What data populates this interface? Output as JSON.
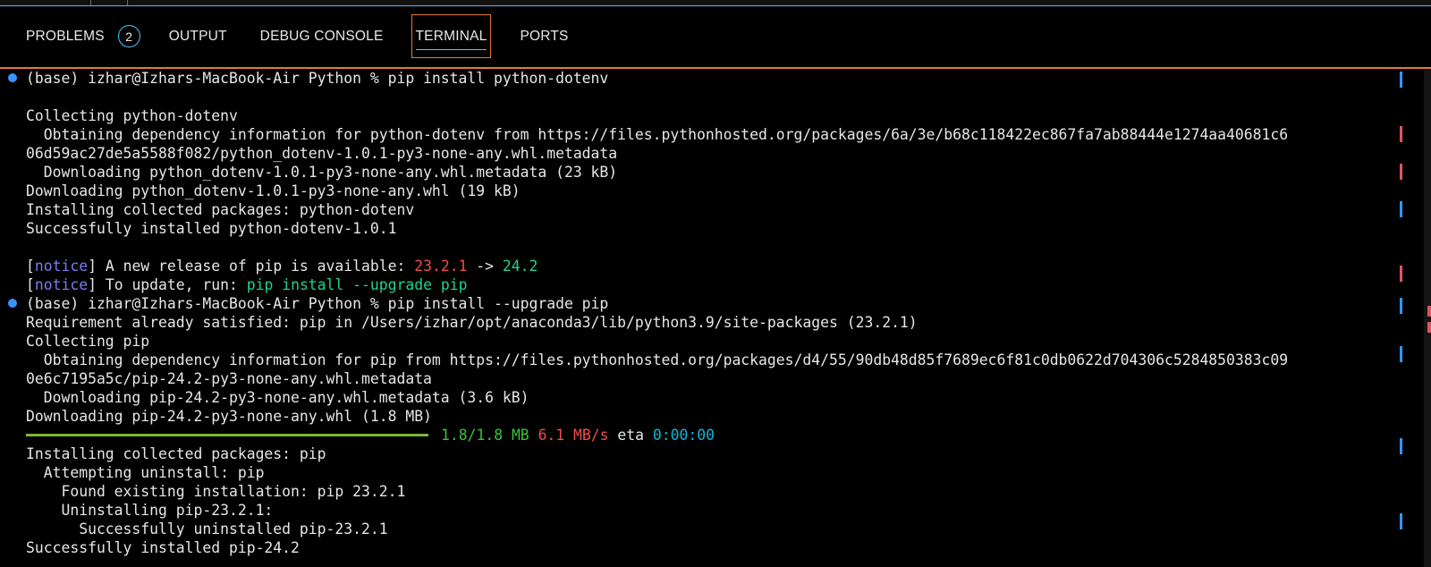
{
  "panel": {
    "tabs": [
      {
        "label": "PROBLEMS",
        "badge": "2"
      },
      {
        "label": "OUTPUT"
      },
      {
        "label": "DEBUG CONSOLE"
      },
      {
        "label": "TERMINAL",
        "active": true
      },
      {
        "label": "PORTS"
      }
    ]
  },
  "colors": {
    "accent_blue": "#4fc1ff",
    "focus_orange": "#e8792a",
    "prompt_dot": "#3794ff",
    "notice": "#7b7bf2",
    "old_version_red": "#f14c4c",
    "new_version_green": "#23d18b"
  },
  "terminal": {
    "prompt1": "(base) izhar@Izhars-MacBook-Air Python % pip install python-dotenv",
    "l_collecting": "Collecting python-dotenv",
    "l_obtain1": "  Obtaining dependency information for python-dotenv from https://files.pythonhosted.org/packages/6a/3e/b68c118422ec867fa7ab88444e1274aa40681c6",
    "l_obtain1b": "06d59ac27de5a5588f082/python_dotenv-1.0.1-py3-none-any.whl.metadata",
    "l_dl_meta1": "  Downloading python_dotenv-1.0.1-py3-none-any.whl.metadata (23 kB)",
    "l_dl1": "Downloading python_dotenv-1.0.1-py3-none-any.whl (19 kB)",
    "l_inst1": "Installing collected packages: python-dotenv",
    "l_succ1": "Successfully installed python-dotenv-1.0.1",
    "notice_bracket_open": "[",
    "notice_word": "notice",
    "notice_bracket_close": "]",
    "notice1_text": " A new release of pip is available: ",
    "notice1_old": "23.2.1",
    "notice1_arrow": " -> ",
    "notice1_new": "24.2",
    "notice2_text": " To update, run: ",
    "notice2_cmd": "pip install --upgrade pip",
    "prompt2": "(base) izhar@Izhars-MacBook-Air Python % pip install --upgrade pip",
    "l_req": "Requirement already satisfied: pip in /Users/izhar/opt/anaconda3/lib/python3.9/site-packages (23.2.1)",
    "l_collecting2": "Collecting pip",
    "l_obtain2": "  Obtaining dependency information for pip from https://files.pythonhosted.org/packages/d4/55/90db48d85f7689ec6f81c0db0622d704306c5284850383c09",
    "l_obtain2b": "0e6c7195a5c/pip-24.2-py3-none-any.whl.metadata",
    "l_dl_meta2": "  Downloading pip-24.2-py3-none-any.whl.metadata (3.6 kB)",
    "l_dl2": "Downloading pip-24.2-py3-none-any.whl (1.8 MB)",
    "progress_fraction": 1.0,
    "progress_size": "1.8/1.8 MB",
    "progress_speed": "6.1 MB/s",
    "progress_eta_label": "eta",
    "progress_eta": "0:00:00",
    "l_inst2": "Installing collected packages: pip",
    "l_attempt": "  Attempting uninstall: pip",
    "l_found": "    Found existing installation: pip 23.2.1",
    "l_uninstalling": "    Uninstalling pip-23.2.1:",
    "l_uninst_ok": "      Successfully uninstalled pip-23.2.1",
    "l_succ2": "Successfully installed pip-24.2"
  }
}
